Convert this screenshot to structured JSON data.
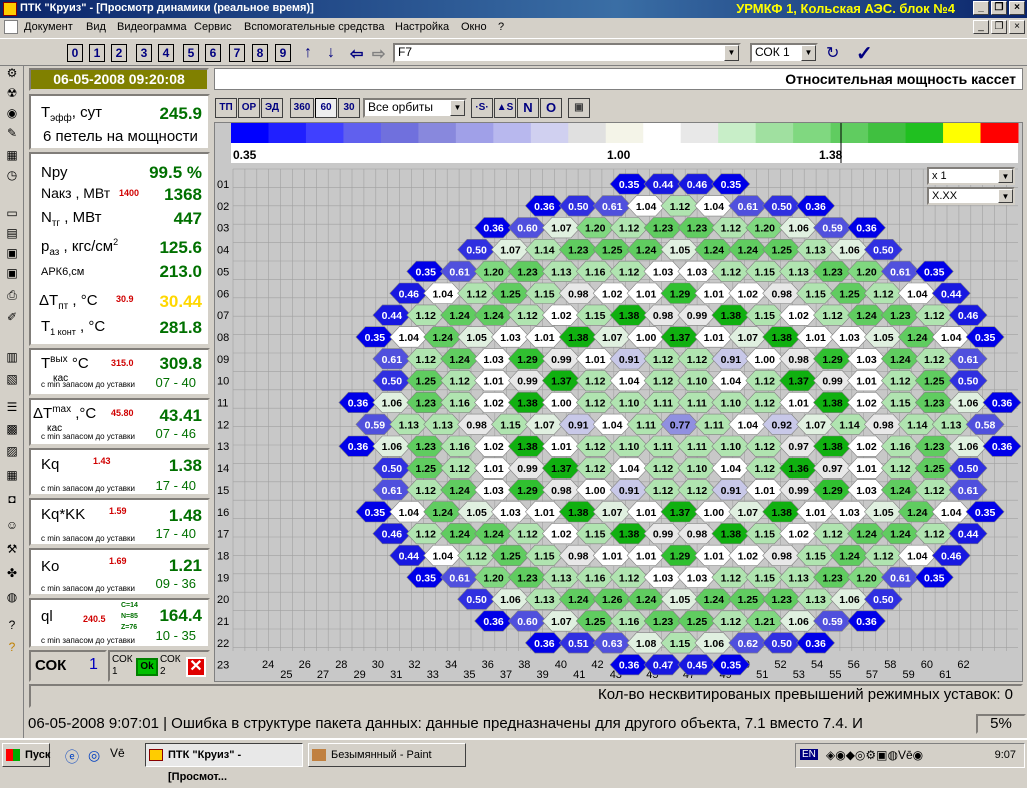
{
  "window": {
    "title": "ПТК \"Круиз\" - [Просмотр динамики (реальное время)]",
    "station": "УРМКФ 1, Кольская АЭС. блок №4"
  },
  "menu": [
    "Документ",
    "Вид",
    "Видеограмма",
    "Сервис",
    "Вспомогательные средства",
    "Настройка",
    "Окно",
    "?"
  ],
  "toolbar": {
    "digits": [
      "0",
      "1",
      "2",
      "3",
      "4",
      "5",
      "6",
      "7",
      "8",
      "9"
    ],
    "param_value": "F7",
    "sok_value": "СОК 1"
  },
  "datetime": "06-05-2008  09:20:08",
  "panels": {
    "teff_label": "Т",
    "teff_sub": "эфф",
    "teff_unit": ", сут",
    "teff_value": "245.9",
    "loops": "6 петель на мощности",
    "npy_label": "Nру",
    "npy_value": "99.5 %",
    "nakz_label": "Nакз , МВт",
    "nakz_red": "1400",
    "nakz_value": "1368",
    "ntg_label": "N",
    "ntg_sub": "тг",
    "ntg_unit": " , МВт",
    "ntg_value": "447",
    "paz_label": "р",
    "paz_sub": "аз",
    "paz_unit": " , кгс/см",
    "paz_sup": "2",
    "paz_value": "125.6",
    "ark_label": "АРК6,см",
    "ark_value": "213.0",
    "dtnt_label": "ΔT",
    "dtnt_sub": "пт",
    "dtnt_unit": " , °С",
    "dtnt_red": "30.9",
    "dtnt_value": "30.44",
    "t1_label": "T",
    "t1_sub": "1 конт",
    "t1_unit": " , °С",
    "t1_value": "281.8",
    "tvyx_label": "T",
    "tvyx_sup": "вых",
    "tvyx_sub": "кас",
    "tvyx_unit": " °С",
    "tvyx_red": "315.0",
    "tvyx_value": "309.8",
    "tvyx_small": "с min запасом до уставки",
    "tvyx_range": "07 - 40",
    "dtmax_label": "ΔT",
    "dtmax_sup": "max",
    "dtmax_sub": "кас",
    "dtmax_unit": " ,°С",
    "dtmax_red": "45.80",
    "dtmax_value": "43.41",
    "dtmax_small": "с min запасом до уставки",
    "dtmax_range": "07 - 46",
    "kq_label": "Kq",
    "kq_red": "1.43",
    "kq_value": "1.38",
    "kq_small": "с min запасом до уставки",
    "kq_range": "17 - 40",
    "kqkk_label": "Kq*KK",
    "kqkk_red": "1.59",
    "kqkk_value": "1.48",
    "kqkk_small": "с min запасом до уставки",
    "kqkk_range": "17 - 40",
    "ko_label": "Ko",
    "ko_red": "1.69",
    "ko_value": "1.21",
    "ko_small": "с min запасом до уставки",
    "ko_range": "09 - 36",
    "ql_label": "ql",
    "ql_red": "240.5",
    "ql_c": "C=14",
    "ql_n": "N=85",
    "ql_z": "Z=76",
    "ql_value": "164.4",
    "ql_small": "с min запасом до уставки",
    "ql_range": "10 - 35"
  },
  "sok": {
    "label": "СОК",
    "value": "1",
    "sok1": "СОК 1",
    "ok": "Ok",
    "sok2": "СОК 2"
  },
  "main": {
    "title": "Относительная мощность кассет",
    "orbit_select": "Все орбиты",
    "scale_min": "0.35",
    "scale_mid": "1.00",
    "scale_max": "1.38",
    "zoom": "x 1",
    "format": "X.XX"
  },
  "buttons": [
    "ТП",
    "ОР",
    "ЭД",
    "360",
    "60",
    "30"
  ],
  "buttons2": [
    "·S·",
    "▲S",
    "N",
    "O"
  ],
  "scale_colors": [
    "#0000ff",
    "#2020ff",
    "#4040ff",
    "#6060ee",
    "#7070dd",
    "#8888dd",
    "#a0a0e8",
    "#b8b8ee",
    "#d0d0f0",
    "#e0e0e0",
    "#f4f4e8",
    "#ffffff",
    "#e8e8e8",
    "#c8eec8",
    "#a0e0a0",
    "#80d880",
    "#60cc60",
    "#40c040",
    "#20c020",
    "#ffff00",
    "#ff0000"
  ],
  "row_labels": [
    "01",
    "02",
    "03",
    "04",
    "05",
    "06",
    "07",
    "08",
    "09",
    "10",
    "11",
    "12",
    "13",
    "14",
    "15",
    "16",
    "17",
    "18",
    "19",
    "20",
    "21",
    "22",
    "23"
  ],
  "col_labels": [
    "24",
    "25",
    "26",
    "27",
    "28",
    "29",
    "30",
    "31",
    "32",
    "33",
    "34",
    "35",
    "36",
    "37",
    "38",
    "39",
    "40",
    "41",
    "42",
    "43",
    "44",
    "45",
    "46",
    "47",
    "48",
    "49",
    "50",
    "51",
    "52",
    "53",
    "54",
    "55",
    "56",
    "57",
    "58",
    "59",
    "60",
    "61",
    "62"
  ],
  "status1": "Кол-во несквитированых превышений режимных уставок:  0",
  "status2": "06-05-2008   9:07:01 | Ошибка в структуре пакета данных: данные предназначены для другого объекта, 7.1 вместо 7.4. И",
  "status2_pct": "5%",
  "taskbar": {
    "start": "Пуск",
    "task1": "ПТК \"Круиз\" - [Просмот...",
    "task2": "Безымянный - Paint",
    "clock": "9:07"
  },
  "core_rows": [
    "0.35 0.44 0.46 0.35",
    "0.36 0.50 0.61 1.04 1.12 1.04 0.61 0.50 0.36",
    "0.36 0.60 1.07 1.20 1.12 1.23 1.23 1.12 1.20 1.06 0.59 0.36",
    "0.50 1.07 1.14 1.23 1.25 1.24 1.05 1.24 1.24 1.25 1.13 1.06 0.50",
    "0.35 0.61 1.20 1.23 1.13 1.16 1.12 1.03 1.03 1.12 1.15 1.13 1.23 1.20 0.61 0.35",
    "0.46 1.04 1.12 1.25 1.15 0.98 1.02 1.01 1.29 1.01 1.02 0.98 1.15 1.25 1.12 1.04 0.44",
    "0.44 1.12 1.24 1.24 1.12 1.02 1.15 1.38 0.98 0.99 1.38 1.15 1.02 1.12 1.24 1.23 1.12 0.46",
    "0.35 1.04 1.24 1.05 1.03 1.01 1.38 1.07 1.00 1.37 1.01 1.07 1.38 1.01 1.03 1.05 1.24 1.04 0.35",
    "0.61 1.12 1.24 1.03 1.29 0.99 1.01 0.91 1.12 1.12 0.91 1.00 0.98 1.29 1.03 1.24 1.12 0.61",
    "0.50 1.25 1.12 1.01 0.99 1.37 1.12 1.04 1.12 1.10 1.04 1.12 1.37 0.99 1.01 1.12 1.25 0.50",
    "0.36 1.06 1.23 1.16 1.02 1.38 1.00 1.12 1.10 1.11 1.11 1.10 1.12 1.01 1.38 1.02 1.15 1.23 1.06 0.36",
    "0.59 1.13 1.13 0.98 1.15 1.07 0.91 1.04 1.11 0.77 1.11 1.04 0.92 1.07 1.14 0.98 1.14 1.13 0.58",
    "0.36 1.06 1.23 1.16 1.02 1.38 1.01 1.12 1.10 1.11 1.11 1.10 1.12 0.97 1.38 1.02 1.16 1.23 1.06 0.36",
    "0.50 1.25 1.12 1.01 0.99 1.37 1.12 1.04 1.12 1.10 1.04 1.12 1.36 0.97 1.01 1.12 1.25 0.50",
    "0.61 1.12 1.24 1.03 1.29 0.98 1.00 0.91 1.12 1.12 0.91 1.01 0.99 1.29 1.03 1.24 1.12 0.61",
    "0.35 1.04 1.24 1.05 1.03 1.01 1.38 1.07 1.01 1.37 1.00 1.07 1.38 1.01 1.03 1.05 1.24 1.04 0.35",
    "0.46 1.12 1.24 1.24 1.12 1.02 1.15 1.38 0.99 0.98 1.38 1.15 1.02 1.12 1.24 1.24 1.12 0.44",
    "0.44 1.04 1.12 1.25 1.15 0.98 1.01 1.01 1.29 1.01 1.02 0.98 1.15 1.24 1.12 1.04 0.46",
    "0.35 0.61 1.20 1.23 1.13 1.16 1.12 1.03 1.03 1.12 1.15 1.13 1.23 1.20 0.61 0.35",
    "0.50 1.06 1.13 1.24 1.26 1.24 1.05 1.24 1.25 1.23 1.13 1.06 0.50",
    "0.36 0.60 1.07 1.25 1.16 1.23 1.25 1.12 1.21 1.06 0.59 0.36",
    "0.36 0.51 0.63 1.08 1.15 1.06 0.62 0.50 0.36",
    "0.36 0.47 0.45 0.35"
  ]
}
